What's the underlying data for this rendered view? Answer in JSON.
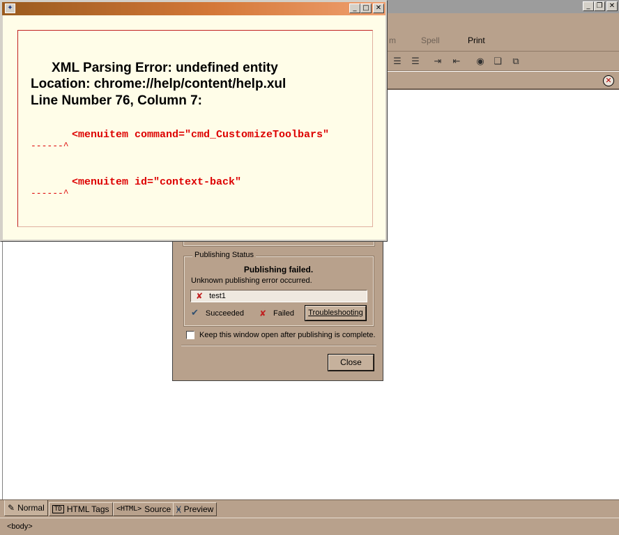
{
  "main_window": {
    "toolbar": {
      "spell_label": "Spell",
      "print_label": "Print",
      "partial_label": "m"
    },
    "mode_tabs": [
      {
        "label": "Normal",
        "icon": "pencil-icon"
      },
      {
        "label": "HTML Tags",
        "icon": "td-tag-icon",
        "glyph": "TD"
      },
      {
        "label": "Source",
        "icon": "html-source-icon",
        "glyph": "<HTML>"
      },
      {
        "label": "Preview",
        "icon": "preview-icon"
      }
    ],
    "status_path": "<body>"
  },
  "publish_dialog": {
    "group_title": "Publishing Status",
    "status_heading": "Publishing failed.",
    "status_detail": "Unknown publishing error occurred.",
    "files": [
      {
        "name": "test1",
        "state": "failed"
      }
    ],
    "legend_succeeded": "Succeeded",
    "legend_failed": "Failed",
    "troubleshooting_label": "Troubleshooting",
    "keep_open_label": "Keep this window open after publishing is complete.",
    "keep_open_checked": false,
    "close_label": "Close"
  },
  "error_window": {
    "title_line": "XML Parsing Error: undefined entity",
    "location_line": "Location: chrome://help/content/help.xul",
    "line_number_line": "Line Number 76, Column 7:",
    "code_line_1": "<menuitem command=\"cmd_CustomizeToolbars\"",
    "caret_1": "------^",
    "code_line_2": "<menuitem id=\"context-back\"",
    "caret_2": "------^"
  },
  "colors": {
    "chrome_tan": "#b8a18c",
    "error_title_gradient_start": "#9a5b1e",
    "error_title_gradient_end": "#f0a070",
    "error_background": "#fffde8",
    "error_code_red": "#dd0000"
  }
}
